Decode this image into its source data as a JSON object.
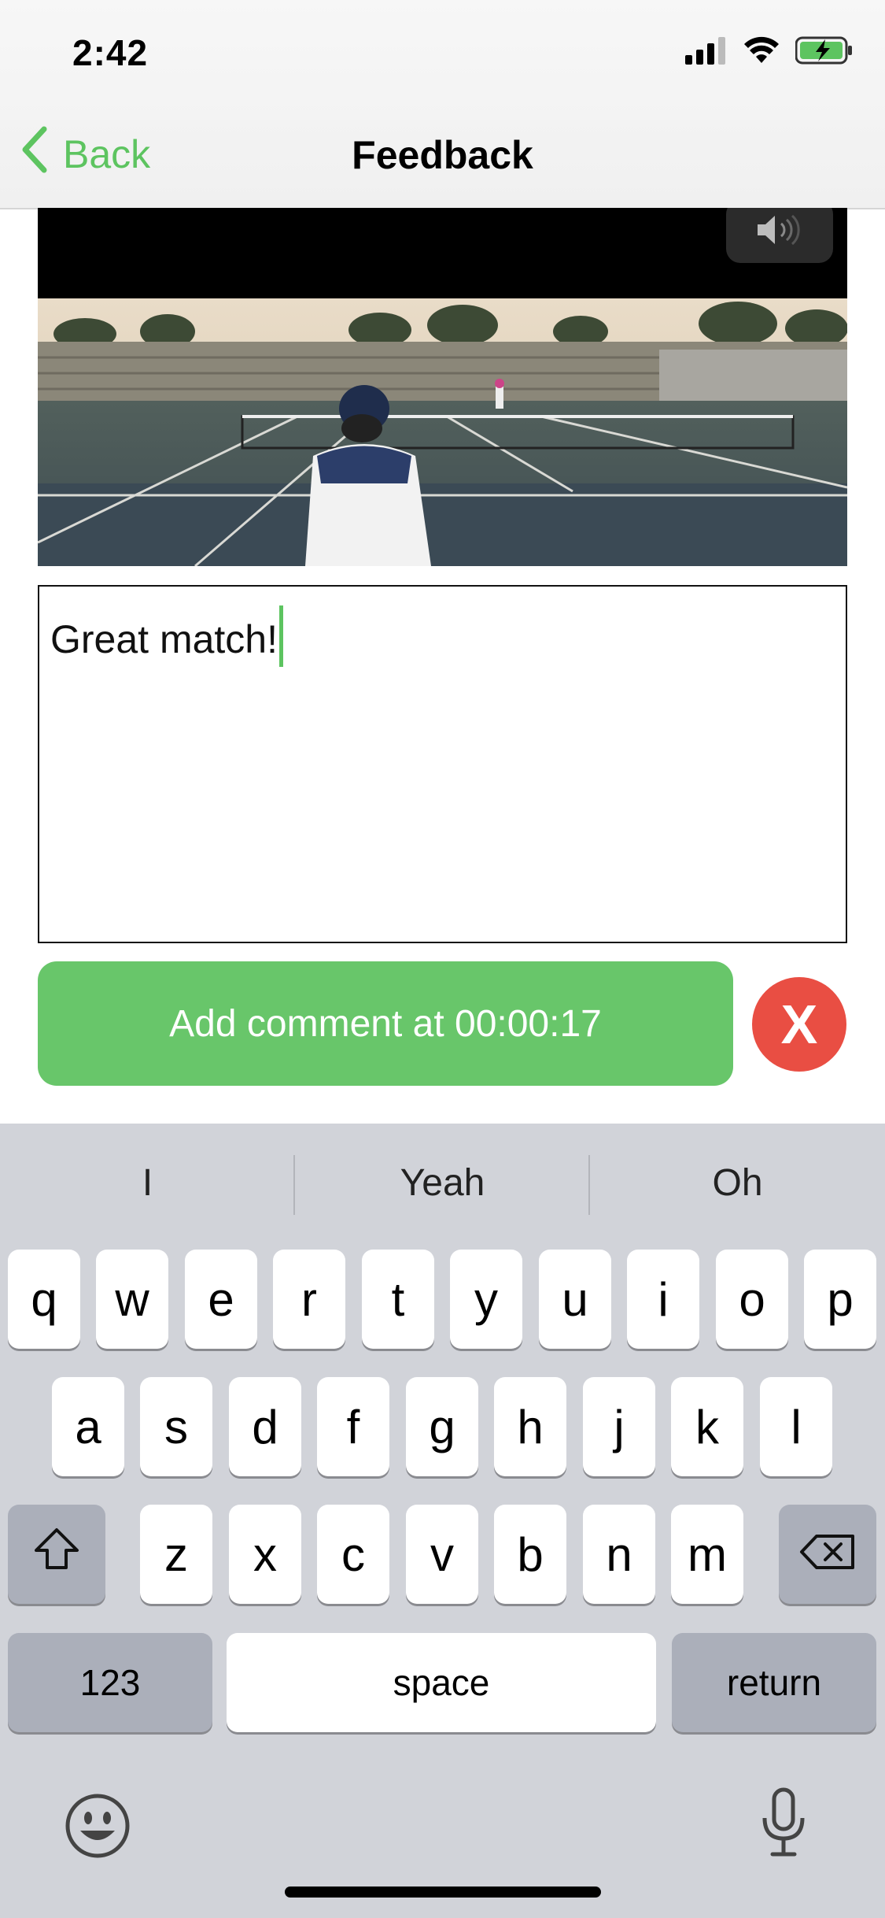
{
  "status_bar": {
    "time": "2:42"
  },
  "nav": {
    "back_label": "Back",
    "title": "Feedback"
  },
  "comment": {
    "value": "Great match!"
  },
  "actions": {
    "add_comment_label": "Add comment at 00:00:17",
    "cancel_label": "X"
  },
  "keyboard": {
    "suggestions": [
      "I",
      "Yeah",
      "Oh"
    ],
    "row1": [
      "q",
      "w",
      "e",
      "r",
      "t",
      "y",
      "u",
      "i",
      "o",
      "p"
    ],
    "row2": [
      "a",
      "s",
      "d",
      "f",
      "g",
      "h",
      "j",
      "k",
      "l"
    ],
    "row3": [
      "z",
      "x",
      "c",
      "v",
      "b",
      "n",
      "m"
    ],
    "numbers_label": "123",
    "space_label": "space",
    "return_label": "return"
  },
  "colors": {
    "accent": "#5dc460",
    "add_button": "#68c66a",
    "cancel_button": "#e94e43",
    "keyboard_bg": "#d1d3d9"
  },
  "icons": [
    "chevron-left-icon",
    "signal-icon",
    "wifi-icon",
    "battery-charging-icon",
    "speaker-icon",
    "shift-icon",
    "backspace-icon",
    "emoji-icon",
    "microphone-icon"
  ]
}
